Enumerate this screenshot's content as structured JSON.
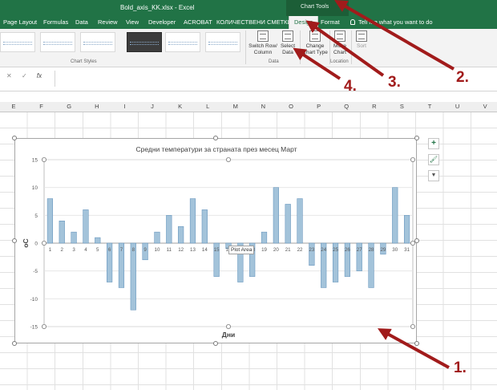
{
  "window": {
    "title": "Bold_axis_KK.xlsx  -  Excel",
    "context_tab_group": "Chart Tools"
  },
  "tabs": [
    {
      "label": "Page Layout"
    },
    {
      "label": "Formulas"
    },
    {
      "label": "Data"
    },
    {
      "label": "Review"
    },
    {
      "label": "View"
    },
    {
      "label": "Developer"
    },
    {
      "label": "ACROBAT"
    },
    {
      "label": "КОЛИЧЕСТВЕНИ СМЕТКИ"
    },
    {
      "label": "Design",
      "active": true
    },
    {
      "label": "Format"
    }
  ],
  "tell_me": "Tell me what you want to do",
  "ribbon": {
    "chart_styles_label": "Chart Styles",
    "switch_row_column": "Switch Row/ Column",
    "select_data": "Select Data",
    "data_group_label": "Data",
    "change_chart_type": "Change Chart Type",
    "move_chart": "Move Chart",
    "location_group_label": "Location",
    "sort": "Sort"
  },
  "formula_bar": {
    "cancel": "✕",
    "enter": "✓",
    "fx": "fx",
    "value": ""
  },
  "columns": [
    "E",
    "F",
    "G",
    "H",
    "I",
    "J",
    "K",
    "L",
    "M",
    "N",
    "O",
    "P",
    "Q",
    "R",
    "S",
    "T",
    "U",
    "V"
  ],
  "plot_area_tooltip": "Plot Area",
  "chart_side_buttons": {
    "elements": "+",
    "styles": "🖌",
    "filters": "▼"
  },
  "chart_data": {
    "type": "bar",
    "title": "Средни температури за страната през месец Март",
    "xlabel": "Дни",
    "ylabel": "оС",
    "categories": [
      "1",
      "2",
      "3",
      "4",
      "5",
      "6",
      "7",
      "8",
      "9",
      "10",
      "11",
      "12",
      "13",
      "14",
      "15",
      "16",
      "17",
      "18",
      "19",
      "20",
      "21",
      "22",
      "23",
      "24",
      "25",
      "26",
      "27",
      "28",
      "29",
      "30",
      "31"
    ],
    "values": [
      8,
      4,
      2,
      6,
      1,
      -7,
      -8,
      -12,
      -3,
      2,
      5,
      3,
      8,
      6,
      -6,
      -1,
      -7,
      -6,
      2,
      10,
      7,
      8,
      -4,
      -8,
      -7,
      -6,
      -5,
      -8,
      -2,
      10,
      5
    ],
    "ylim": [
      -15,
      15
    ],
    "yticks": [
      -15,
      -10,
      -5,
      0,
      5,
      10,
      15
    ],
    "grid": true,
    "bar_color": "#a3c3da",
    "bar_edge_color": "#5b8db8"
  },
  "annotations": [
    {
      "label": "1."
    },
    {
      "label": "2."
    },
    {
      "label": "3."
    },
    {
      "label": "4."
    }
  ],
  "colors": {
    "excel_green": "#217346",
    "annotation_red": "#a11b1b"
  }
}
